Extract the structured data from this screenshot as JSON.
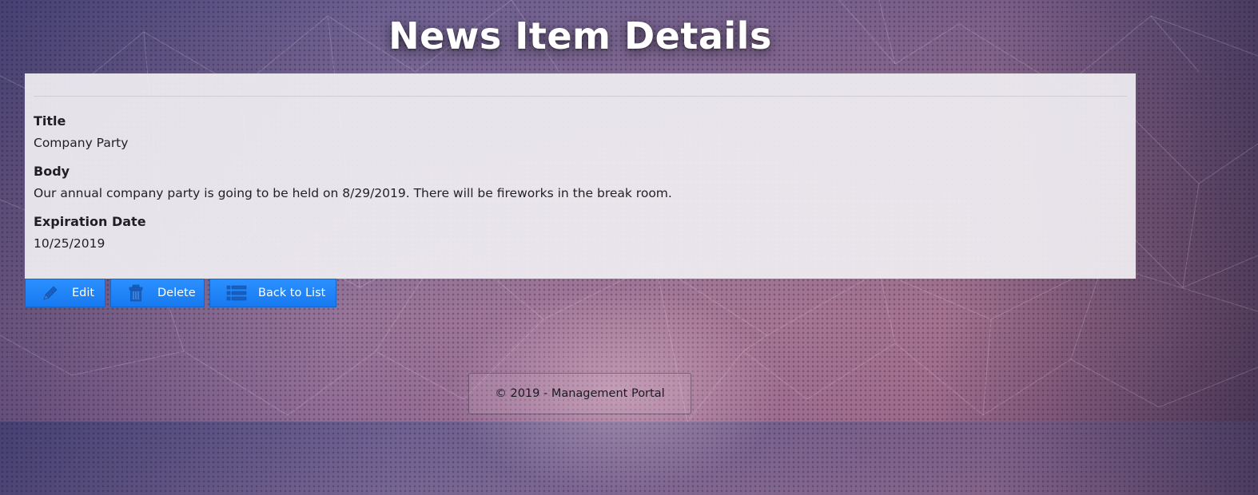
{
  "page": {
    "title": "News Item Details"
  },
  "details": {
    "fields": [
      {
        "label": "Title",
        "value": "Company Party"
      },
      {
        "label": "Body",
        "value": "Our annual company party is going to be held on 8/29/2019. There will be fireworks in the break room."
      },
      {
        "label": "Expiration Date",
        "value": "10/25/2019"
      }
    ]
  },
  "actions": {
    "edit": {
      "label": "Edit",
      "icon": "pencil-icon"
    },
    "delete": {
      "label": "Delete",
      "icon": "trash-icon"
    },
    "back": {
      "label": "Back to List",
      "icon": "list-icon"
    }
  },
  "footer": {
    "text": "© 2019 - Management Portal"
  },
  "colors": {
    "button": "#1f85ff",
    "panel": "#f0eef2",
    "title": "#ffffff"
  }
}
